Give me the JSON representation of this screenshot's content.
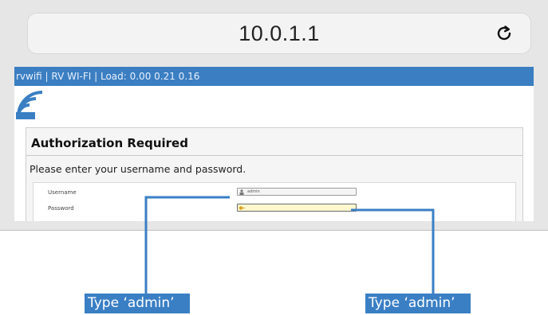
{
  "browser": {
    "url": "10.0.1.1",
    "reload_icon": "reload-icon"
  },
  "page": {
    "status_bar": "rvwifi | RV WI-FI | Load: 0.00 0.21 0.16",
    "logo_text": "RV Wi-Fi",
    "auth": {
      "title": "Authorization Required",
      "description": "Please enter your username and password.",
      "username_label": "Username",
      "username_value": "admin",
      "password_label": "Password",
      "password_value": ""
    }
  },
  "callouts": {
    "left_label": "Type ‘admin’",
    "right_label": "Type ‘admin’"
  },
  "colors": {
    "accent_blue": "#3a7fc4",
    "status_bar_bg": "#3b7ec2"
  }
}
